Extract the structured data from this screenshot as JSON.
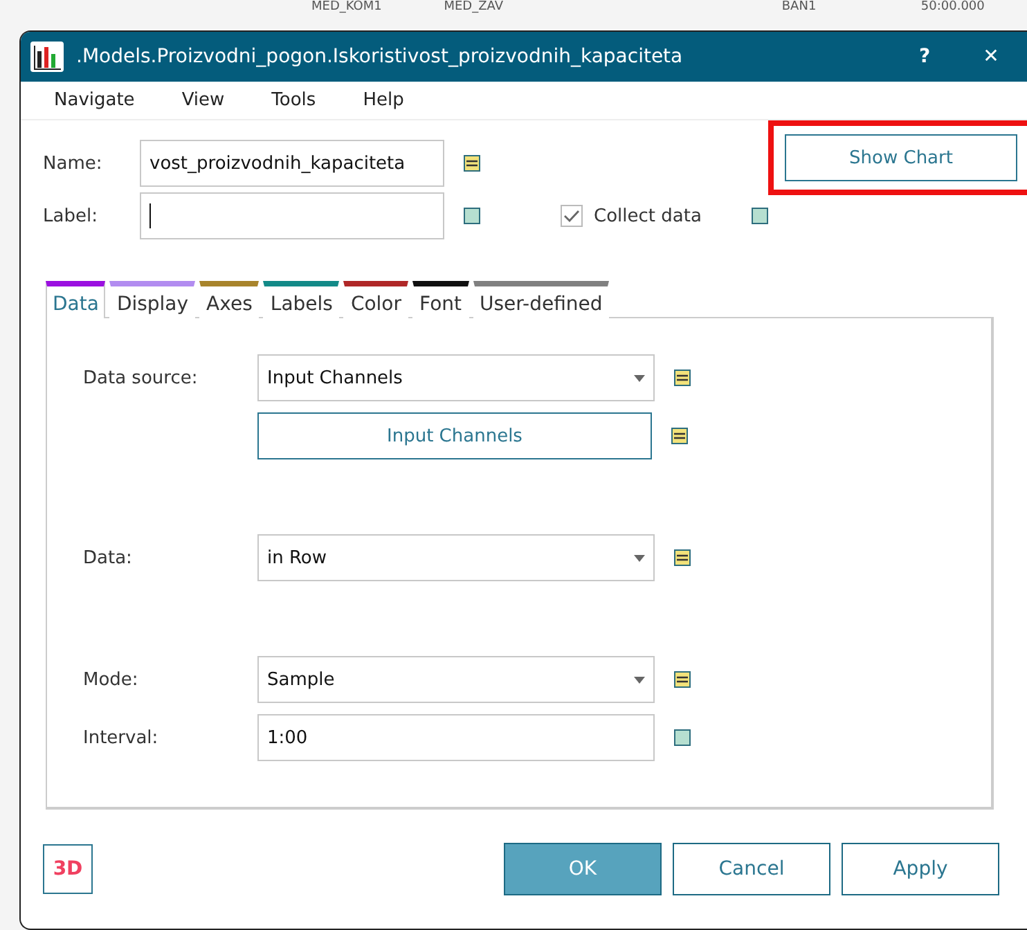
{
  "background_texts": [
    "MED_KOM1",
    "MED_ZAV",
    "BAN1",
    "50:00.000"
  ],
  "window": {
    "title": ".Models.Proizvodni_pogon.Iskoristivost_proizvodnih_kapaciteta",
    "help": "?",
    "close": "✕"
  },
  "menu": [
    "Navigate",
    "View",
    "Tools",
    "Help"
  ],
  "name_field": {
    "label": "Name:",
    "value": "vost_proizvodnih_kapaciteta",
    "indicator": {
      "kind": "dynamic"
    }
  },
  "label_field": {
    "label": "Label:",
    "indicator": {
      "kind": "static"
    }
  },
  "collect_data": {
    "label": "Collect data",
    "checked": true,
    "indicator": {
      "kind": "static"
    }
  },
  "show_chart_button": {
    "label": "Show Chart",
    "highlighted": true
  },
  "tabs": [
    {
      "label": "Data",
      "selected": true,
      "color": "#9b10e0"
    },
    {
      "label": "Display",
      "selected": false,
      "color": "#b28cf0"
    },
    {
      "label": "Axes",
      "selected": false,
      "color": "#a8842c"
    },
    {
      "label": "Labels",
      "selected": false,
      "color": "#138a88"
    },
    {
      "label": "Color",
      "selected": false,
      "color": "#b02828"
    },
    {
      "label": "Font",
      "selected": false,
      "color": "#101010"
    },
    {
      "label": "User-defined",
      "selected": false,
      "color": "#808080"
    }
  ],
  "rows": [
    {
      "kind": "dropdown",
      "label": "Data source:",
      "value": "Input Channels",
      "indicator": {
        "kind": "dynamic"
      }
    },
    {
      "kind": "button",
      "value": "Input Channels",
      "indicator": {
        "kind": "dynamic"
      }
    },
    {
      "kind": "dropdown",
      "label": "Data:",
      "value": "in Row",
      "indicator": {
        "kind": "dynamic"
      }
    },
    {
      "kind": "dropdown",
      "label": "Mode:",
      "value": "Sample",
      "indicator": {
        "kind": "dynamic"
      }
    },
    {
      "kind": "text",
      "label": "Interval:",
      "value": "1:00",
      "indicator": {
        "kind": "static"
      }
    }
  ],
  "footer": {
    "three_d": "3D",
    "buttons": [
      {
        "label": "OK",
        "primary": true
      },
      {
        "label": "Cancel",
        "primary": false
      },
      {
        "label": "Apply",
        "primary": false
      }
    ]
  }
}
